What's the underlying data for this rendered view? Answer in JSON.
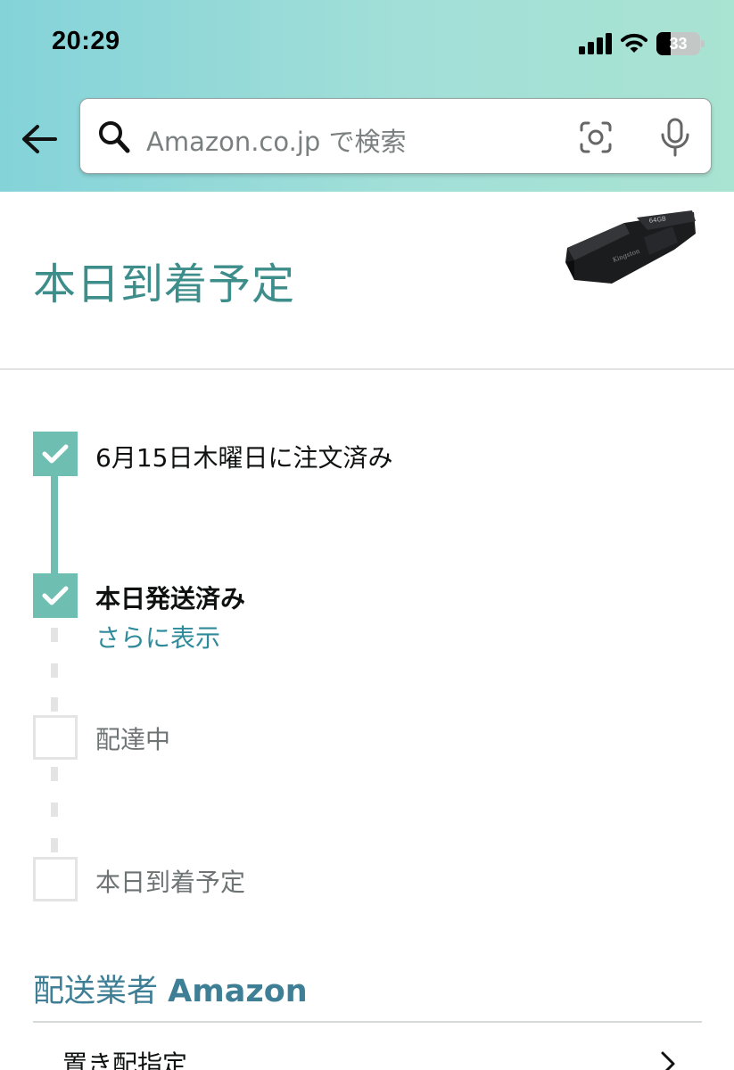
{
  "status_bar": {
    "time": "20:29",
    "battery_level": "33"
  },
  "search": {
    "placeholder": "Amazon.co.jp で検索"
  },
  "page": {
    "title": "本日到着予定"
  },
  "icons": {
    "back": "back-arrow-icon",
    "search": "search-icon",
    "camera": "camera-scan-icon",
    "mic": "microphone-icon"
  },
  "tracking": {
    "steps": [
      {
        "label": "6月15日木曜日に注文済み",
        "done": true
      },
      {
        "label": "本日発送済み",
        "done": true,
        "link": "さらに表示"
      },
      {
        "label": "配達中",
        "done": false
      },
      {
        "label": "本日到着予定",
        "done": false
      }
    ]
  },
  "carrier": {
    "prefix": "配送業者",
    "name": "Amazon"
  },
  "options": {
    "delivery_preference": "置き配指定"
  },
  "colors": {
    "accent_teal": "#6fbeb2",
    "title_teal": "#3d8d8b",
    "link": "#2f8a9a",
    "carrier": "#3e7f96",
    "header_gradient_start": "#84d3d9",
    "header_gradient_end": "#a9e3d2"
  }
}
